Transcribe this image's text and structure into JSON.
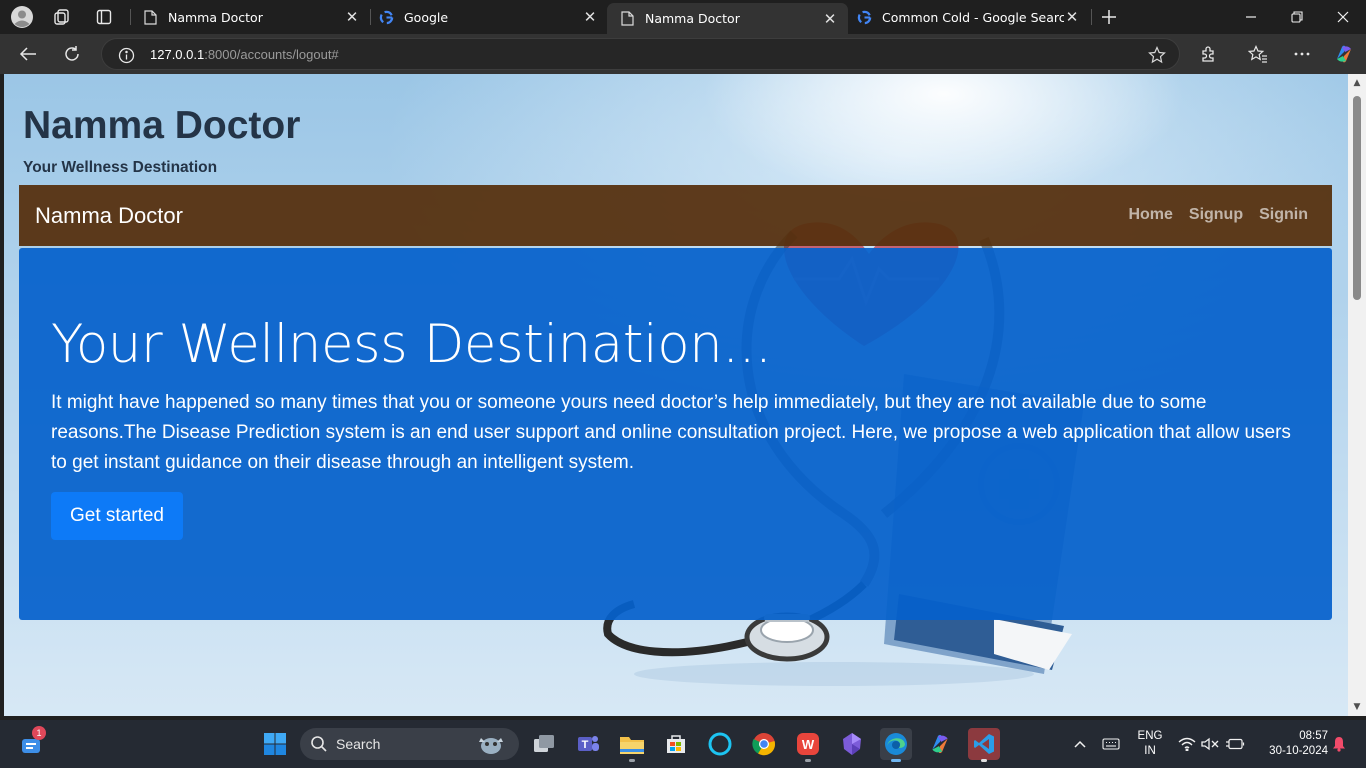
{
  "browser": {
    "tabs": [
      {
        "title": "Namma Doctor",
        "favicon": "page-icon"
      },
      {
        "title": "Google",
        "favicon": "google-icon"
      },
      {
        "title": "Namma Doctor",
        "favicon": "page-icon",
        "active": true
      },
      {
        "title": "Common Cold - Google Search",
        "favicon": "google-icon"
      }
    ],
    "url_host": "127.0.0.1",
    "url_rest": ":8000/accounts/logout#"
  },
  "page": {
    "site_title": "Namma Doctor",
    "site_subtitle": "Your Wellness Destination",
    "navbar": {
      "brand": "Namma Doctor",
      "links": [
        "Home",
        "Signup",
        "Signin"
      ]
    },
    "hero": {
      "heading": "Your Wellness Destination...",
      "text": "It might have happened so many times that you or someone yours need doctor’s help immediately, but they are not available due to some reasons.The Disease Prediction system is an end user support and online consultation project. Here, we propose a web application that allow users to get instant guidance on their disease through an intelligent system.",
      "button": "Get started"
    }
  },
  "taskbar": {
    "search_label": "Search",
    "chat_badge": "1",
    "lang_line1": "ENG",
    "lang_line2": "IN",
    "time": "08:57",
    "date": "30-10-2024"
  },
  "colors": {
    "navbar_bg": "#56300e",
    "hero_bg": "#0561cb",
    "button_bg": "#0d7af7"
  }
}
